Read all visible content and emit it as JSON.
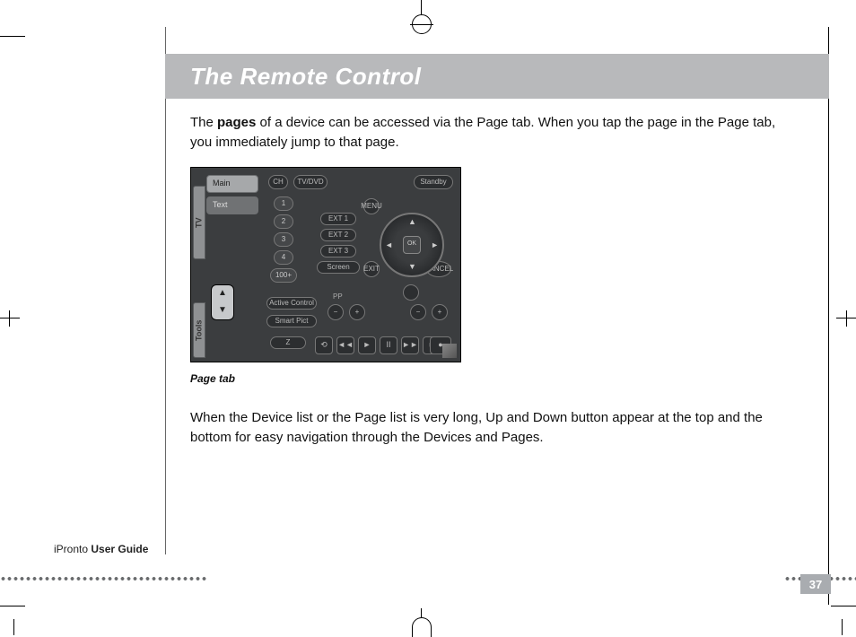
{
  "header": {
    "title": "The Remote Control"
  },
  "body": {
    "p1_a": "The ",
    "p1_bold": "pages",
    "p1_b": " of a device can be accessed via the Page tab. When you tap the page in the Page tab, you immediately jump to that page.",
    "caption": "Page tab",
    "p2": "When the Device list or the Page list is very long, Up and Down button appear at the top and the bottom for easy navigation through the Devices and Pages."
  },
  "figure": {
    "sidebar": {
      "tv_tab": "TV",
      "tools_tab": "Tools",
      "pages": [
        "Main",
        "Text"
      ],
      "scroll_up": "▲",
      "scroll_down": "▼"
    },
    "remote": {
      "top_left_pill": "CH",
      "tvdvd": "TV/DVD",
      "standby": "Standby",
      "nums": [
        "1",
        "2",
        "3",
        "4",
        "100+"
      ],
      "ext": [
        "EXT 1",
        "EXT 2",
        "EXT 3"
      ],
      "screen": "Screen",
      "menu": "MENU",
      "ok": "OK",
      "exit": "EXIT",
      "cancel": "CANCEL",
      "active_ctrl": "Active Control",
      "smart_pict": "Smart Pict",
      "z_label": "Z",
      "pp_label": "PP",
      "v_plus": "+",
      "v_minus": "−",
      "arrows": {
        "u": "▲",
        "d": "▼",
        "l": "◄",
        "r": "►"
      },
      "media": [
        "⟲",
        "◄◄",
        "►",
        "II",
        "►►",
        "■",
        "●"
      ]
    }
  },
  "footer": {
    "product": "iPronto",
    "guide": " User Guide",
    "page_number": "37"
  }
}
